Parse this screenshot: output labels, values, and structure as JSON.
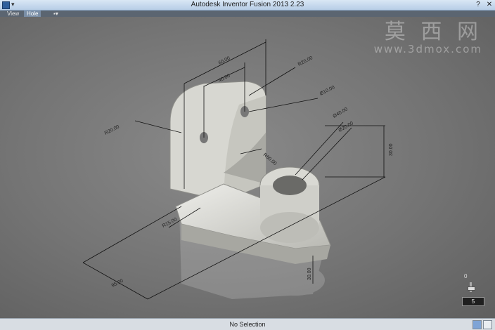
{
  "window": {
    "title": "Autodesk Inventor Fusion 2013    2.23"
  },
  "tabs": [
    {
      "label": "View"
    },
    {
      "label": "Hole"
    }
  ],
  "watermark": {
    "chinese": "莫 西 网",
    "url": "www.3dmox.com"
  },
  "dimensions": {
    "d1": "60.00",
    "d2": "40.00",
    "d3": "R20.00",
    "d4": "Ø10.00",
    "d5": "R20.00",
    "d6": "R60.00",
    "d7": "Ø40.00",
    "d8": "Ø20.00",
    "d9": "30.00",
    "d10": "R15.00",
    "d11": "95.00",
    "d12": "30.00"
  },
  "side": {
    "label": "0",
    "zoom_value": "5"
  },
  "status": {
    "text": "No Selection"
  },
  "colors": {
    "titlebar": "#c9dbef",
    "viewport": "#747474",
    "model": "#dcdcd6"
  }
}
